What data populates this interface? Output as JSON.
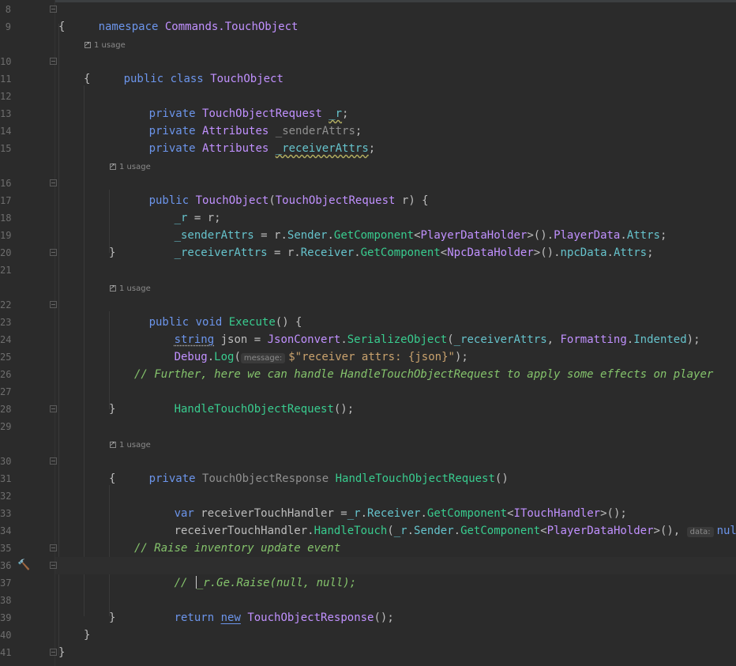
{
  "editor": {
    "line_numbers": [
      "8",
      "9",
      "10",
      "11",
      "12",
      "13",
      "14",
      "15",
      "16",
      "17",
      "18",
      "19",
      "20",
      "21",
      "22",
      "23",
      "24",
      "25",
      "26",
      "27",
      "28",
      "29",
      "30",
      "31",
      "32",
      "33",
      "34",
      "35",
      "36",
      "37",
      "38",
      "39",
      "40",
      "41"
    ],
    "usage_hints": {
      "class": "1 usage",
      "ctor": "1 usage",
      "execute": "1 usage",
      "handle": "1 usage"
    },
    "param_hints": {
      "message": "message:",
      "data": "data:"
    },
    "code": {
      "l8": {
        "kw": "namespace",
        "ns": "Commands.TouchObject"
      },
      "l9": "{",
      "l10": {
        "kw1": "public",
        "kw2": "class",
        "name": "TouchObject"
      },
      "l11": "{",
      "l12": {
        "kw": "private",
        "type": "TouchObjectRequest",
        "field": "_r",
        "end": ";"
      },
      "l13": {
        "kw": "private",
        "type": "Attributes",
        "field": "_senderAttrs",
        "end": ";"
      },
      "l14": {
        "kw": "private",
        "type": "Attributes",
        "field": "_receiverAttrs",
        "end": ";"
      },
      "l16": {
        "kw": "public",
        "name": "TouchObject",
        "open": "(",
        "ptype": "TouchObjectRequest",
        "pname": " r) {"
      },
      "l17": {
        "field": "_r",
        "rest": " = r;"
      },
      "l18": {
        "field": "_senderAttrs",
        "eq": " = r.",
        "p1": "Sender",
        "dot": ".",
        "m": "GetComponent",
        "lt": "<",
        "t": "PlayerDataHolder",
        "gt": ">().",
        "p2": "PlayerData",
        "dot2": ".",
        "p3": "Attrs",
        "end": ";"
      },
      "l19": {
        "field": "_receiverAttrs",
        "eq": " = r.",
        "p1": "Receiver",
        "dot": ".",
        "m": "GetComponent",
        "lt": "<",
        "t": "NpcDataHolder",
        "gt": ">().",
        "p2": "npcData",
        "dot2": ".",
        "p3": "Attrs",
        "end": ";"
      },
      "l20": "}",
      "l22": {
        "kw1": "public",
        "kw2": "void",
        "m": "Execute",
        "rest": "() {"
      },
      "l23": {
        "kw": "string",
        "v": " json = ",
        "t": "JsonConvert",
        "dot": ".",
        "m": "SerializeObject",
        "open": "(",
        "f": "_receiverAttrs",
        "comma": ", ",
        "t2": "Formatting",
        "dot2": ".",
        "e": "Indented",
        "end": ");"
      },
      "l24": {
        "t": "Debug",
        "dot": ".",
        "m": "Log",
        "open": "(",
        "s": "$\"receiver attrs: {json}\"",
        "end": ");"
      },
      "l26": "// Further, here we can handle HandleTouchObjectRequest to apply some effects on player",
      "l27": {
        "m": "HandleTouchObjectRequest",
        "end": "();"
      },
      "l28": "}",
      "l30": {
        "kw": "private",
        "t": "TouchObjectResponse",
        "m": "HandleTouchObjectRequest",
        "end": "()"
      },
      "l31": "{",
      "l32": {
        "kw": "var",
        "v": " receiverTouchHandler =",
        "f": "_r",
        "dot": ".",
        "p": "Receiver",
        "dot2": ".",
        "m": "GetComponent",
        "lt": "<",
        "t": "ITouchHandler",
        "gt": ">();"
      },
      "l33": {
        "v": "receiverTouchHandler.",
        "m": "HandleTouch",
        "open": "(",
        "f": "_r",
        "dot": ".",
        "p": "Sender",
        "dot2": ".",
        "m2": "GetComponent",
        "lt": "<",
        "t": "PlayerDataHolder",
        "gt": ">(), ",
        "kw": "null",
        "end": ");"
      },
      "l35": "// Raise inventory update event",
      "l36a": "// ",
      "l36b": "_r.Ge.Raise(null, null);",
      "l38": {
        "kw": "return",
        "kw2": "new",
        "t": "TouchObjectResponse",
        "end": "();"
      },
      "l39": "}",
      "l40": "}",
      "l41": "}"
    }
  },
  "gutter_icons": {
    "line36": "hammer-icon"
  },
  "colors": {
    "background": "#2b2b2b",
    "keyword": "#6c95eb",
    "type": "#c191ff",
    "method": "#39cc8f",
    "field": "#66c3cc",
    "comment": "#85c46c",
    "string": "#c9a26d"
  }
}
